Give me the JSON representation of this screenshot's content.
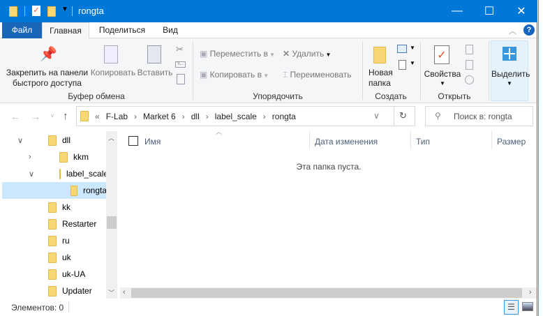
{
  "window": {
    "title": "rongta"
  },
  "title_buttons": {
    "minimize": "—",
    "maximize": "☐",
    "close": "✕"
  },
  "tabs": [
    {
      "label": "Файл"
    },
    {
      "label": "Главная"
    },
    {
      "label": "Поделиться"
    },
    {
      "label": "Вид"
    }
  ],
  "ribbon": {
    "clipboard": {
      "pin": "Закрепить на панели",
      "pin2": "быстрого доступа",
      "copy": "Копировать",
      "paste": "Вставить",
      "label": "Буфер обмена"
    },
    "organize": {
      "move": "Переместить в",
      "copy_to": "Копировать в",
      "delete": "Удалить",
      "rename": "Переименовать",
      "label": "Упорядочить"
    },
    "create": {
      "new_folder": "Новая",
      "new_folder2": "папка",
      "label": "Создать"
    },
    "open": {
      "properties": "Свойства",
      "label": "Открыть"
    },
    "select": {
      "label": "Выделить"
    }
  },
  "address": {
    "prefix": "«",
    "crumbs": [
      "F-Lab",
      "Market 6",
      "dll",
      "label_scale",
      "rongta"
    ],
    "search_placeholder": "Поиск в: rongta"
  },
  "nav": [
    {
      "label": "dll",
      "indent": 0,
      "expander": "v"
    },
    {
      "label": "kkm",
      "indent": 1,
      "expander": ">"
    },
    {
      "label": "label_scale",
      "indent": 1,
      "expander": "v"
    },
    {
      "label": "rongta",
      "indent": 2,
      "expander": "",
      "selected": true
    },
    {
      "label": "kk",
      "indent": 0,
      "expander": ""
    },
    {
      "label": "Restarter",
      "indent": 0,
      "expander": ""
    },
    {
      "label": "ru",
      "indent": 0,
      "expander": ""
    },
    {
      "label": "uk",
      "indent": 0,
      "expander": ""
    },
    {
      "label": "uk-UA",
      "indent": 0,
      "expander": ""
    },
    {
      "label": "Updater",
      "indent": 0,
      "expander": ""
    }
  ],
  "columns": {
    "name": "Имя",
    "date": "Дата изменения",
    "type": "Тип",
    "size": "Размер"
  },
  "empty_message": "Эта папка пуста.",
  "status": {
    "items": "Элементов: 0"
  }
}
